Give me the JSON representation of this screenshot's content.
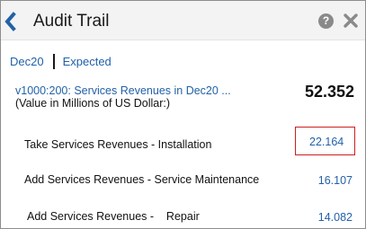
{
  "header": {
    "title": "Audit Trail",
    "help_symbol": "?",
    "back_icon": "chevron-left-icon",
    "close_icon": "close-icon"
  },
  "breadcrumb": {
    "items": [
      "Dec20",
      "Expected"
    ]
  },
  "summary": {
    "account_label": "v1000:200: Services Revenues in Dec20 ...",
    "unit_note": "(Value in Millions of US Dollar:)",
    "total": "52.352"
  },
  "rows": [
    {
      "label": "Take Services Revenues - Installation",
      "value": "22.164"
    },
    {
      "label": "Add Services Revenues - Service Maintenance",
      "value": "16.107"
    },
    {
      "label": "Add Services Revenues -    Repair",
      "value": "14.082"
    }
  ],
  "colors": {
    "link": "#2261a8",
    "highlight_border": "#cc1f1f",
    "header_bg": "#f3f3f3"
  }
}
